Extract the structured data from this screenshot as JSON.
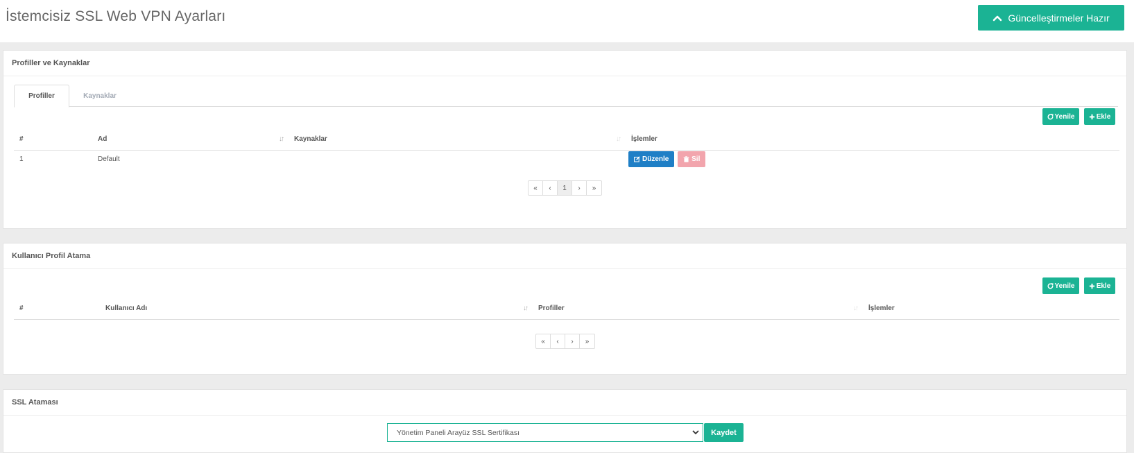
{
  "header": {
    "title": "İstemcisiz SSL Web VPN Ayarları",
    "updates_button": "Güncelleştirmeler Hazır"
  },
  "profiles_panel": {
    "title": "Profiller ve Kaynaklar",
    "tabs": [
      {
        "label": "Profiller",
        "active": true
      },
      {
        "label": "Kaynaklar",
        "active": false
      }
    ],
    "refresh_label": "Yenile",
    "add_label": "Ekle",
    "columns": [
      "#",
      "Ad",
      "Kaynaklar",
      "İşlemler"
    ],
    "rows": [
      {
        "num": "1",
        "name": "Default",
        "resources": "",
        "edit_label": "Düzenle",
        "delete_label": "Sil"
      }
    ],
    "pagination": [
      "«",
      "‹",
      "1",
      "›",
      "»"
    ]
  },
  "user_panel": {
    "title": "Kullanıcı Profil Atama",
    "refresh_label": "Yenile",
    "add_label": "Ekle",
    "columns": [
      "#",
      "Kullanıcı Adı",
      "Profiller",
      "İşlemler"
    ],
    "pagination": [
      "«",
      "‹",
      "›",
      "»"
    ]
  },
  "ssl_panel": {
    "title": "SSL Ataması",
    "selected_certificate": "Yönetim Paneli Arayüz SSL Sertifikası",
    "save_label": "Kaydet"
  },
  "colors": {
    "accent": "#1bb394",
    "edit": "#1f7fc6",
    "delete": "#f2a5ad"
  },
  "icons": {
    "updates": "chevron-up-icon",
    "refresh": "refresh-icon",
    "add": "plus-icon",
    "edit": "edit-icon",
    "delete": "trash-icon",
    "select": "chevron-down-icon"
  }
}
